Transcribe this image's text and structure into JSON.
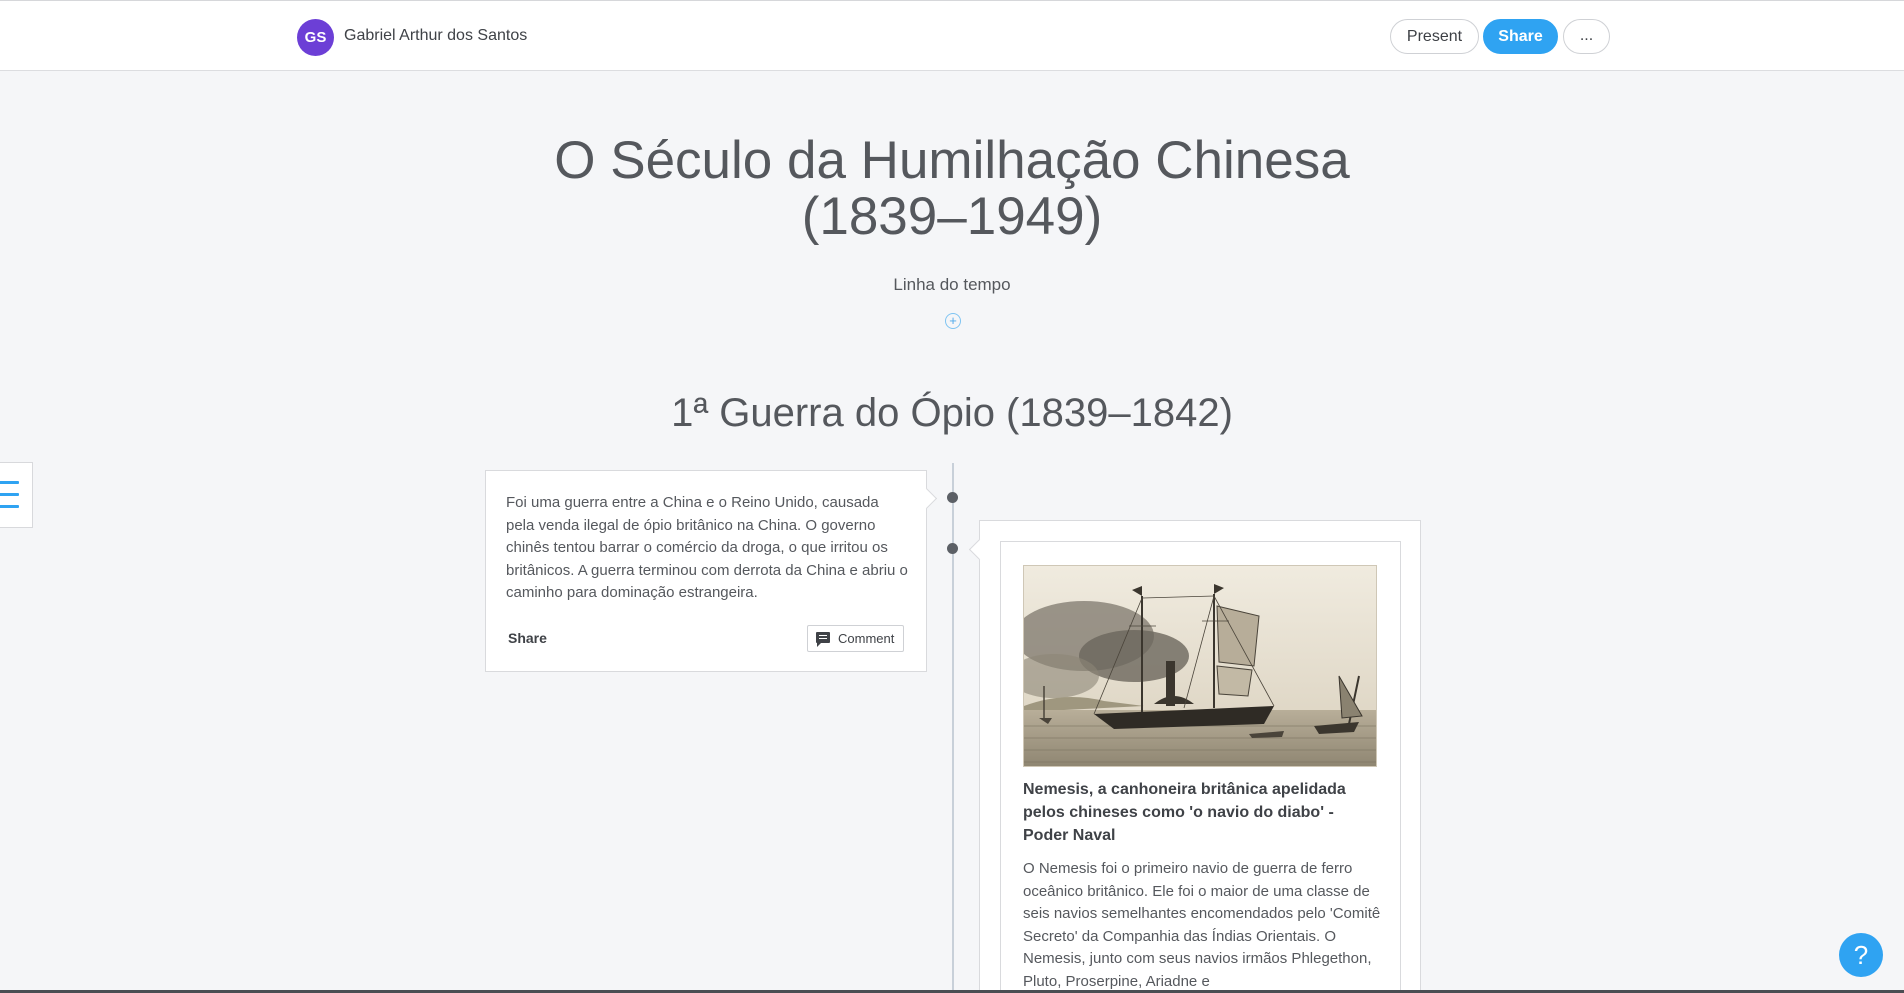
{
  "header": {
    "avatar_initials": "GS",
    "author_name": "Gabriel Arthur dos Santos",
    "present_label": "Present",
    "share_label": "Share",
    "more_label": "...",
    "accent_color": "#2fa3f2",
    "avatar_color": "#6c3fd6"
  },
  "page": {
    "title_line1": "O Século da Humilhação Chinesa",
    "title_line2": "(1839–1949)",
    "subtitle": "Linha do tempo",
    "add_icon": "plus-circle-icon"
  },
  "section": {
    "title": "1ª Guerra do Ópio (1839–1842)"
  },
  "left_card": {
    "text": "Foi uma guerra entre a China e o Reino Unido, causada pela venda ilegal de ópio britânico na China. O governo chinês tentou barrar o comércio da droga, o que irritou os britânicos. A guerra terminou com derrota da China e abriu o caminho para dominação estrangeira.",
    "share_label": "Share",
    "comment_label": "Comment"
  },
  "right_card": {
    "image": "ship-engraving",
    "title": "Nemesis, a canhoneira britânica apelidada pelos chineses como 'o navio do diabo' - Poder Naval",
    "body": "O Nemesis foi o primeiro navio de guerra de ferro oceânico britânico. Ele foi o maior de uma classe de seis navios semelhantes encomendados pelo 'Comitê Secreto' da Companhia das Índias Orientais. O Nemesis, junto com seus navios irmãos Phlegethon, Pluto, Proserpine, Ariadne e"
  },
  "help": {
    "label": "?"
  }
}
